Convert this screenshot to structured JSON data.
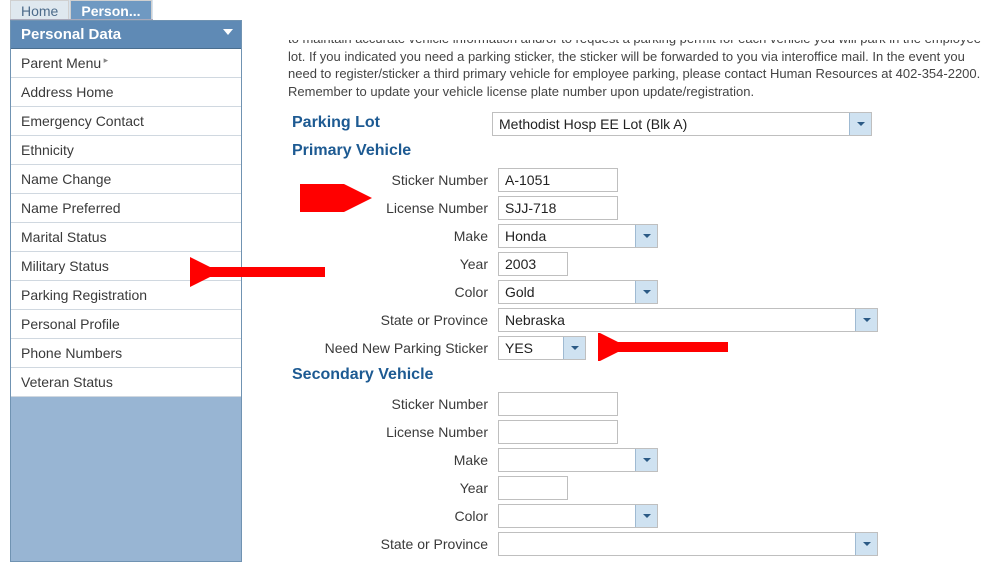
{
  "tabs": {
    "home": "Home",
    "person": "Person..."
  },
  "sidebar": {
    "header": "Personal Data",
    "items": [
      "Parent Menu",
      "Address Home",
      "Emergency Contact",
      "Ethnicity",
      "Name Change",
      "Name Preferred",
      "Marital Status",
      "Military Status",
      "Parking Registration",
      "Personal Profile",
      "Phone Numbers",
      "Veteran Status"
    ]
  },
  "intro": "to maintain accurate vehicle information and/or to request a parking permit for each vehicle you will park in the employee lot. If you indicated you need a parking sticker, the sticker will be forwarded to you via interoffice mail. In the event you need to register/sticker a third primary vehicle for employee parking, please contact Human Resources at 402-354-2200. Remember to update your vehicle license plate number upon update/registration.",
  "labels": {
    "parking_lot": "Parking Lot",
    "primary_vehicle": "Primary Vehicle",
    "secondary_vehicle": "Secondary Vehicle",
    "sticker_number": "Sticker Number",
    "license_number": "License Number",
    "make": "Make",
    "year": "Year",
    "color": "Color",
    "state": "State or Province",
    "need_sticker": "Need New Parking Sticker"
  },
  "values": {
    "parking_lot": "Methodist Hosp EE Lot (Blk A)",
    "primary": {
      "sticker_number": "A-1051",
      "license_number": "SJJ-718",
      "make": "Honda",
      "year": "2003",
      "color": "Gold",
      "state": "Nebraska",
      "need_sticker": "YES"
    },
    "secondary": {
      "sticker_number": "",
      "license_number": "",
      "make": "",
      "year": "",
      "color": "",
      "state": "",
      "need_sticker": ""
    }
  }
}
